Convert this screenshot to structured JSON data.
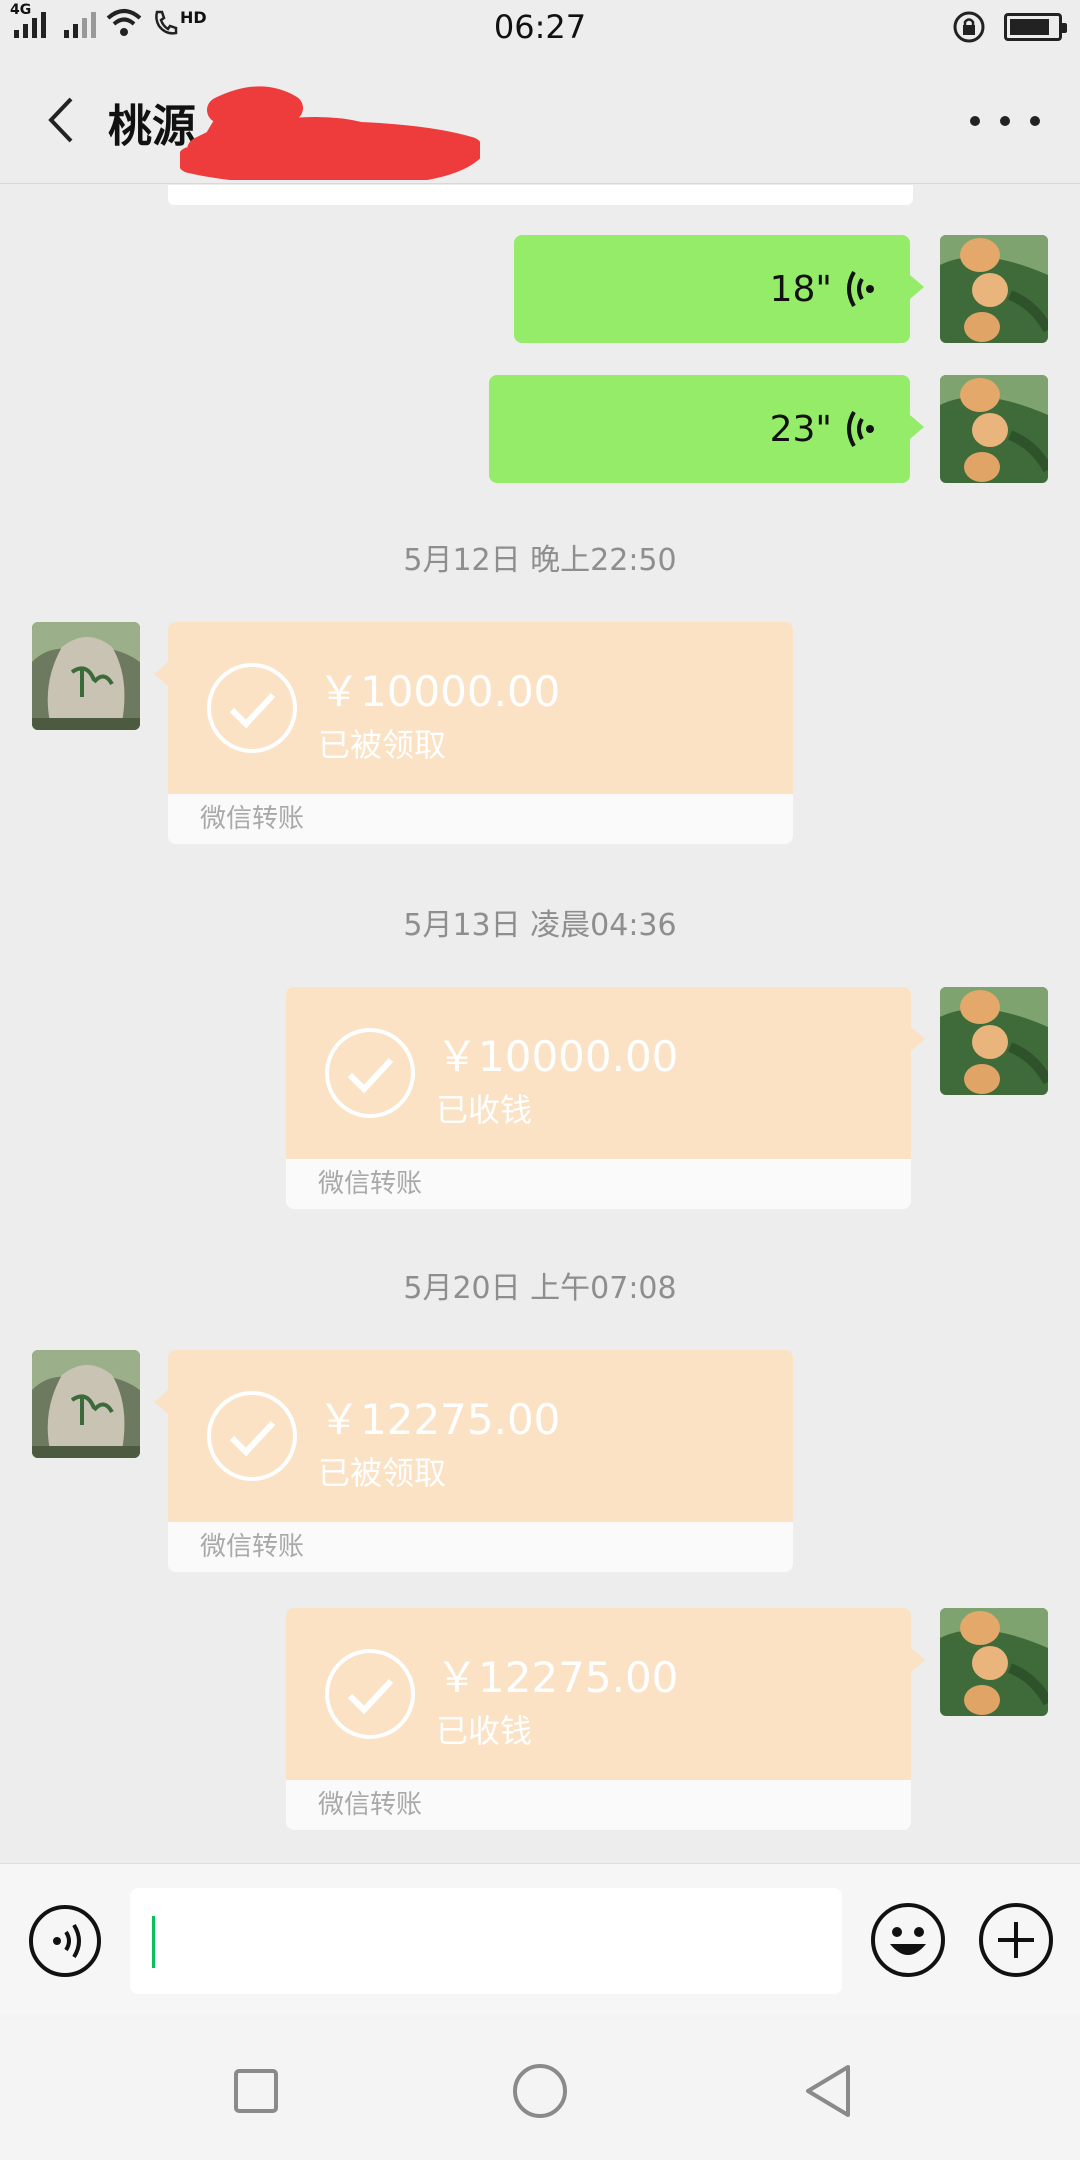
{
  "status_bar": {
    "time": "06:27",
    "signal1_type": "4G",
    "call_badge": "HD"
  },
  "header": {
    "title": "桃源"
  },
  "messages": {
    "voice1": {
      "duration": "18\""
    },
    "voice2": {
      "duration": "23\""
    },
    "stamp1": "5月12日 晚上22:50",
    "transfer1": {
      "amount": "￥10000.00",
      "status": "已被领取",
      "footer": "微信转账"
    },
    "stamp2": "5月13日 凌晨04:36",
    "transfer2": {
      "amount": "￥10000.00",
      "status": "已收钱",
      "footer": "微信转账"
    },
    "stamp3": "5月20日 上午07:08",
    "transfer3": {
      "amount": "￥12275.00",
      "status": "已被领取",
      "footer": "微信转账"
    },
    "transfer4": {
      "amount": "￥12275.00",
      "status": "已收钱",
      "footer": "微信转账"
    }
  },
  "colors": {
    "voice_bubble": "#95ec69",
    "transfer_card": "#fbe2c5",
    "background": "#ededed",
    "redaction": "#ee3b3b",
    "caret": "#07c160"
  },
  "icons": {
    "back": "chevron-left-icon",
    "more": "more-dots-icon",
    "voice_wave": "voice-wave-icon",
    "check": "check-circle-icon",
    "voice_input": "voice-input-icon",
    "emoji": "emoji-icon",
    "plus": "plus-icon",
    "nav_recent": "square-icon",
    "nav_home": "circle-icon",
    "nav_back": "triangle-back-icon"
  }
}
